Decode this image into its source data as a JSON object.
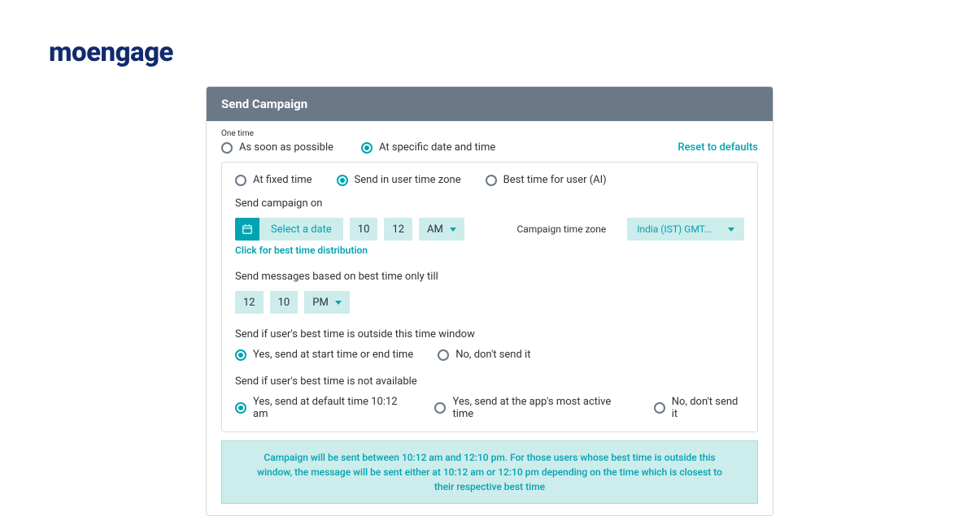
{
  "logo": "moengage",
  "header": "Send Campaign",
  "section_label": "One time",
  "schedule_opts": [
    {
      "label": "As soon as possible",
      "selected": false
    },
    {
      "label": "At specific date and time",
      "selected": true
    }
  ],
  "reset_link": "Reset to defaults",
  "time_mode_opts": [
    {
      "label": "At fixed time",
      "selected": false
    },
    {
      "label": "Send in user time zone",
      "selected": true
    },
    {
      "label": "Best time for user (AI)",
      "selected": false
    }
  ],
  "send_on_label": "Send campaign on",
  "date_picker_text": "Select a date",
  "start_hour": "10",
  "start_min": "12",
  "start_ampm": "AM",
  "tz_label": "Campaign time zone",
  "tz_value": "India (IST) GMT...",
  "best_time_link": "Click for best time distribution",
  "till_label": "Send messages based on best time only till",
  "end_hour": "12",
  "end_min": "10",
  "end_ampm": "PM",
  "outside_q": "Send if user's best time is outside this time window",
  "outside_opts": [
    {
      "label": "Yes, send at start time or end time",
      "selected": true
    },
    {
      "label": "No, don't send it",
      "selected": false
    }
  ],
  "na_q": "Send if user's best time is not available",
  "na_opts": [
    {
      "label": "Yes, send at default time 10:12 am",
      "selected": true
    },
    {
      "label": "Yes, send at the app's most active time",
      "selected": false
    },
    {
      "label": "No, don't send it",
      "selected": false
    }
  ],
  "info": "Campaign will be sent between 10:12 am and 12:10 pm. For those users whose best time is outside this window, the message will be sent either at 10:12 am or 12:10 pm depending on the time which is closest to their respective best time"
}
